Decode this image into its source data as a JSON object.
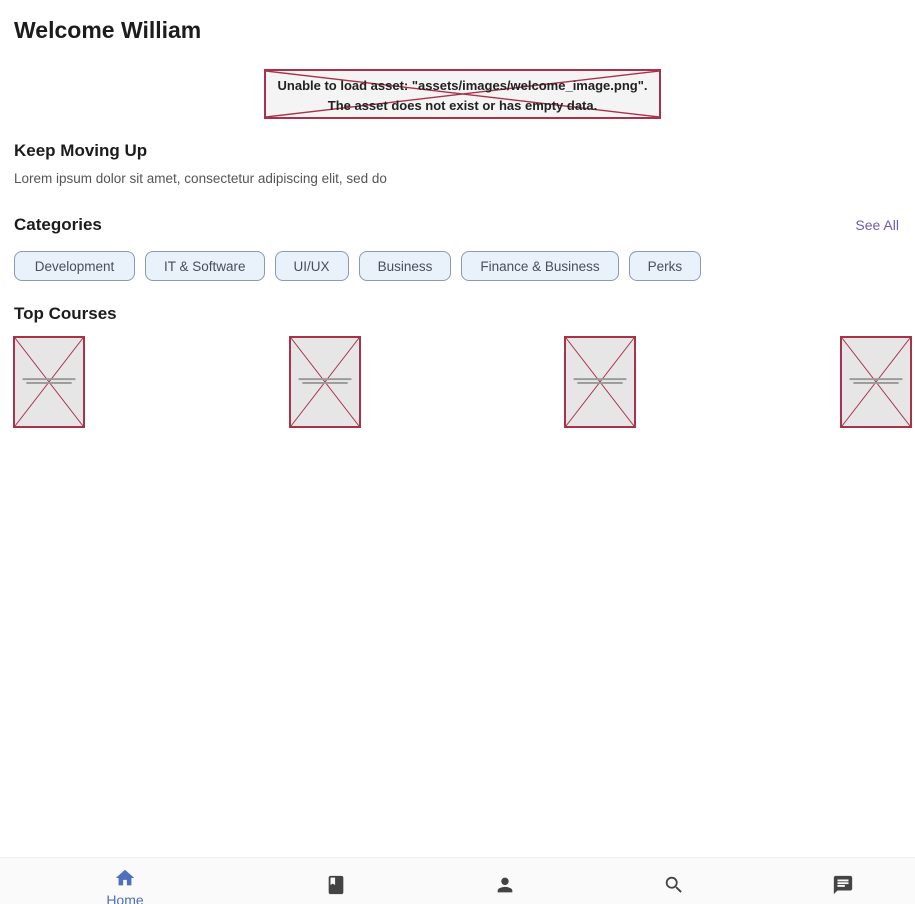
{
  "header": {
    "title": "Welcome William"
  },
  "welcome_image": {
    "error_line1": "Unable to load asset: \"assets/images/welcome_image.png\".",
    "error_line2": "The asset does not exist or has empty data."
  },
  "keep_moving": {
    "title": "Keep Moving Up",
    "description": "Lorem ipsum dolor sit amet, consectetur adipiscing elit, sed do"
  },
  "categories": {
    "title": "Categories",
    "see_all": "See All",
    "chips": [
      "Development",
      "IT & Software",
      "UI/UX",
      "Business",
      "Finance & Business",
      "Perks"
    ]
  },
  "top_courses": {
    "title": "Top Courses",
    "count": 4
  },
  "bottom_nav": {
    "active": "Home",
    "items": [
      {
        "icon": "home-icon",
        "label": "Home"
      },
      {
        "icon": "book-icon",
        "label": ""
      },
      {
        "icon": "person-icon",
        "label": ""
      },
      {
        "icon": "search-icon",
        "label": ""
      },
      {
        "icon": "chat-icon",
        "label": ""
      }
    ]
  },
  "colors": {
    "accent": "#4f6fbd",
    "link": "#6a5bb5",
    "error_border": "#a8324a",
    "chip_bg": "#e9f1fb",
    "nav_icon_inactive": "#444444"
  }
}
